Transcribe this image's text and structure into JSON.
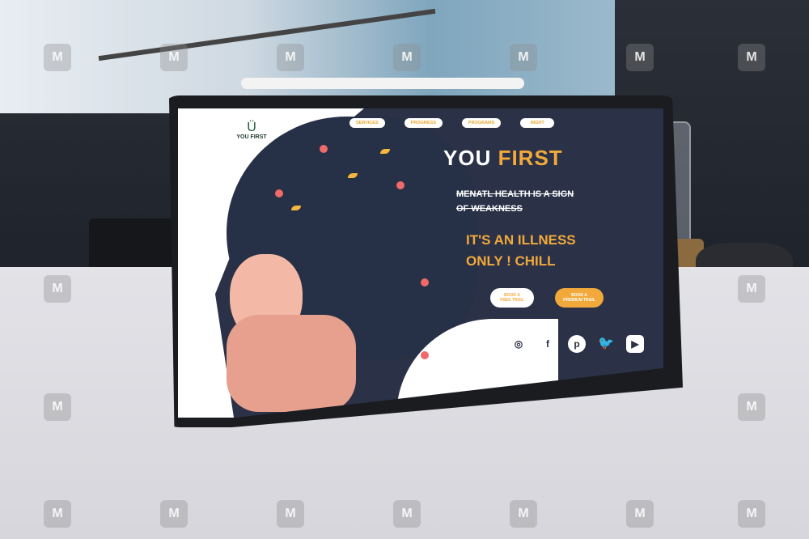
{
  "site": {
    "logo_mark": "Ü",
    "logo_text": "YOU FIRST",
    "nav": [
      {
        "label": "SERVICES"
      },
      {
        "label": "PROGRESS"
      },
      {
        "label": "PROGRAMS"
      },
      {
        "label": "NIGHT"
      }
    ],
    "hero": {
      "title_part1": "YOU ",
      "title_part2": "FIRST",
      "strike_line1": "MENATL HEALTH IS A SIGN",
      "strike_line2": "OF WEAKNESS",
      "tagline_line1": "IT'S AN ILLNESS",
      "tagline_line2": "ONLY ! CHILL",
      "cta_free": "BOOK A FREE TRAIL",
      "cta_premium": "BOOK A PREMIUM TRAIL"
    },
    "social": {
      "instagram": "◎",
      "facebook": "f",
      "pinterest": "p",
      "twitter": "🐦",
      "youtube": "▶"
    }
  },
  "watermark": "M",
  "colors": {
    "accent": "#f2a93b",
    "dark_bg": "#2b3147",
    "white": "#ffffff"
  }
}
